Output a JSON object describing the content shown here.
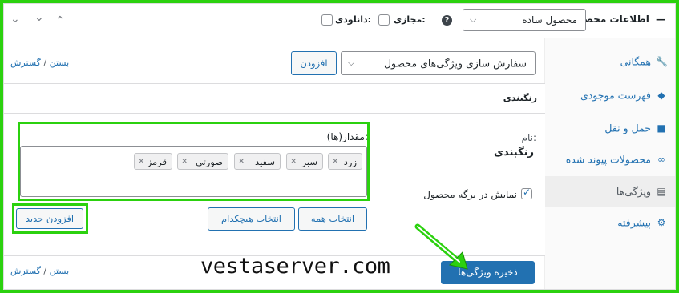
{
  "header": {
    "title": "اطلاعات محصول",
    "product_type": "محصول ساده",
    "help_icon": "?",
    "virtual_label": "مجازی:",
    "downloadable_label": "دانلودی:"
  },
  "sidebar": {
    "items": [
      {
        "label": "همگانی",
        "icon": "wrench-icon"
      },
      {
        "label": "فهرست موجودی",
        "icon": "tag-icon"
      },
      {
        "label": "حمل و نقل",
        "icon": "truck-icon"
      },
      {
        "label": "محصولات پیوند شده",
        "icon": "link-icon"
      },
      {
        "label": "ویژگی‌ها",
        "icon": "list-icon"
      },
      {
        "label": "پیشرفته",
        "icon": "gear-icon"
      }
    ],
    "active_index": 4
  },
  "attributes": {
    "select_label": "سفارش سازی ویژگی‌های محصول",
    "add_button": "افزودن",
    "expand_link": "گسترش",
    "separator": "/",
    "close_link": "بستن",
    "panel_title": "رنگبندی",
    "name_label": "نام:",
    "name_value": "رنگبندی",
    "values_label": "مقدار(ها):",
    "tags": [
      "زرد",
      "سبز",
      "سفید",
      "صورتی",
      "قرمز"
    ],
    "visible_on_product_label": "نمایش در برگه محصول",
    "select_all": "انتخاب همه",
    "select_none": "انتخاب هیچکدام",
    "add_new": "افزودن جدید",
    "save_button": "ذخیره ویژگی‌ها"
  },
  "watermark": "vestaserver.com",
  "colors": {
    "highlight": "#2bd10e",
    "accent": "#2271b1"
  }
}
